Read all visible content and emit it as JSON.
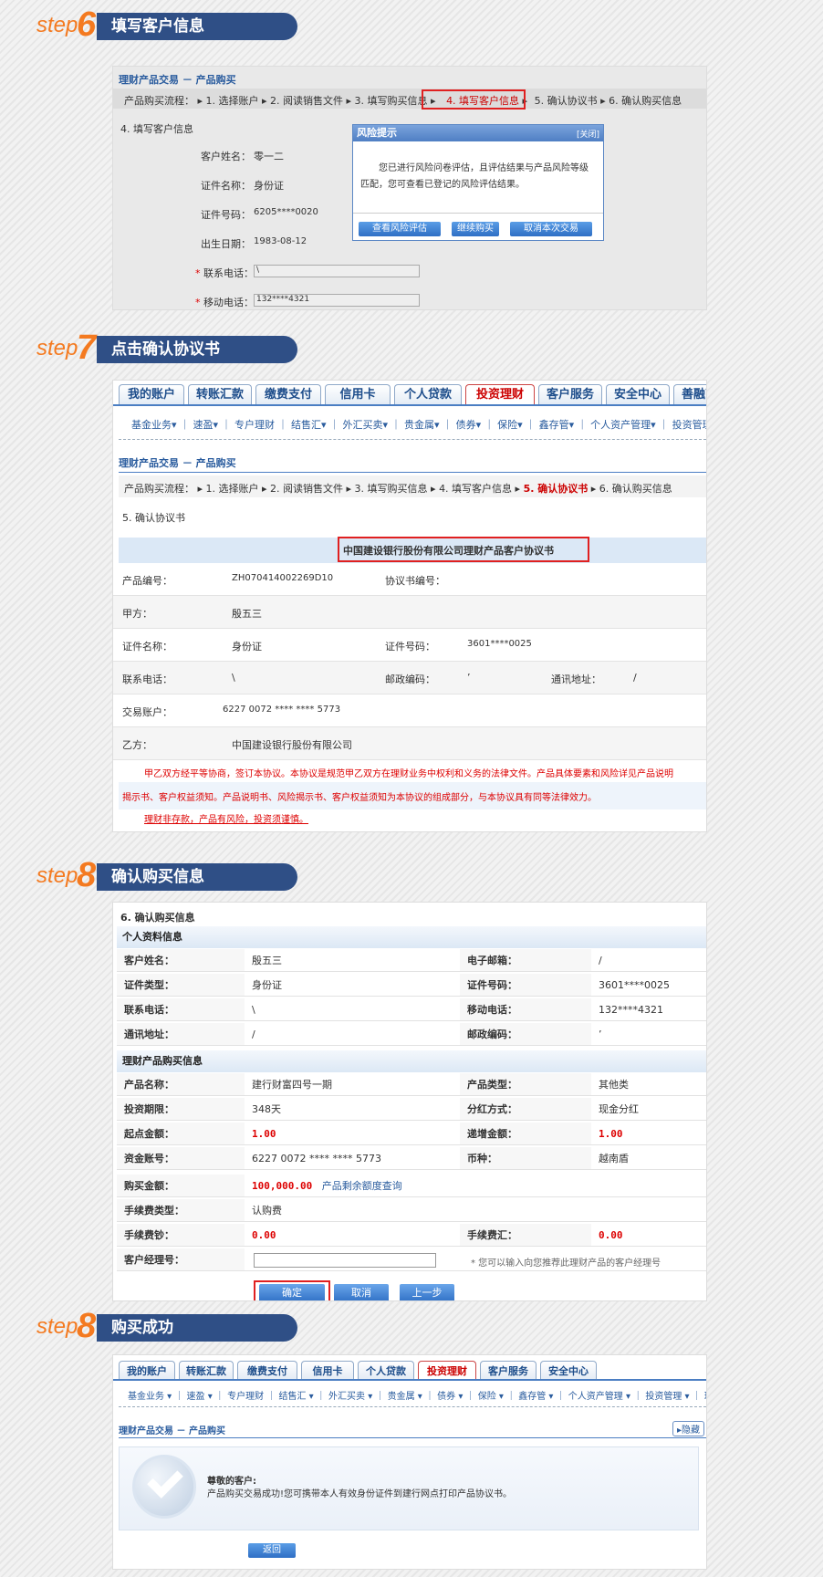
{
  "steps": [
    {
      "word": "step",
      "num": "6",
      "title": "填写客户信息"
    },
    {
      "word": "step",
      "num": "7",
      "title": "点击确认协议书"
    },
    {
      "word": "step",
      "num": "8",
      "title": "确认购买信息"
    },
    {
      "word": "step",
      "num": "8",
      "title": "购买成功"
    }
  ],
  "common": {
    "crumb": "理财产品交易 － 产品购买",
    "flow": [
      "产品购买流程：",
      "1. 选择账户",
      "2. 阅读销售文件",
      "3. 填写购买信息",
      "4. 填写客户信息",
      "5. 确认协议书",
      "6. 确认购买信息"
    ],
    "tabs": [
      "我的账户",
      "转账汇款",
      "缴费支付",
      "信用卡",
      "个人贷款",
      "投资理财",
      "客户服务",
      "安全中心",
      "善融商务"
    ],
    "subnav7": "基金业务▾ ｜ 速盈▾ ｜ 专户理财 ｜ 结售汇▾ ｜ 外汇买卖▾ ｜ 贵金属▾ ｜ 债券▾ ｜ 保险▾ ｜ 鑫存管▾ ｜ 个人资产管理▾ ｜ 投资管理",
    "subnav9": "基金业务 ▾ ｜ 速盈 ▾ ｜ 专户理财 ｜ 结售汇 ▾ ｜ 外汇买卖 ▾ ｜ 贵金属 ▾ ｜ 债券 ▾ ｜ 保险 ▾ ｜ 鑫存管 ▾ ｜ 个人资产管理 ▾ ｜ 投资管理 ▾ ｜ 理财产品"
  },
  "p6": {
    "section": "4. 填写客户信息",
    "fields": [
      {
        "label": "客户姓名：",
        "value": "零一二"
      },
      {
        "label": "证件名称：",
        "value": "身份证"
      },
      {
        "label": "证件号码：",
        "value": "6205****0020"
      },
      {
        "label": "出生日期：",
        "value": "1983-08-12"
      },
      {
        "label": "联系电话：",
        "value": "\\"
      },
      {
        "label": "移动电话：",
        "value": "132****4321"
      }
    ],
    "dialog": {
      "title": "风险提示",
      "close": "[关闭]",
      "text1": "您已进行风险问卷评估，且评估结果与产品风险等级",
      "text2": "匹配，您可查看已登记的风险评估结果。",
      "buttons": [
        "查看风险评估",
        "继续购买",
        "取消本次交易"
      ]
    }
  },
  "p7": {
    "section": "5. 确认协议书",
    "agreement_title": "中国建设银行股份有限公司理财产品客户协议书",
    "rows": [
      {
        "a": "产品编号：",
        "b": "ZH070414002269D10",
        "c": "协议书编号：",
        "d": "",
        "e": "",
        "f": ""
      },
      {
        "a": "甲方：",
        "b": "殷五三",
        "c": "",
        "d": "",
        "e": "",
        "f": ""
      },
      {
        "a": "证件名称：",
        "b": "身份证",
        "c": "证件号码：",
        "d": "3601****0025",
        "e": "",
        "f": ""
      },
      {
        "a": "联系电话：",
        "b": "\\",
        "c": "邮政编码：",
        "d": "’",
        "e": "通讯地址：",
        "f": "/"
      },
      {
        "a": "交易账户：",
        "b": "6227 0072 **** **** 5773",
        "c": "",
        "d": "",
        "e": "",
        "f": ""
      },
      {
        "a": "乙方：",
        "b": "中国建设银行股份有限公司",
        "c": "",
        "d": "",
        "e": "",
        "f": ""
      }
    ],
    "terms1": "甲乙双方经平等协商，签订本协议。本协议是规范甲乙双方在理财业务中权利和义务的法律文件。产品具体要素和风险详见产品说明",
    "terms2": "揭示书、客户权益须知。产品说明书、风险揭示书、客户权益须知为本协议的组成部分，与本协议具有同等法律效力。",
    "warning": "理财非存款，产品有风险，投资须谨慎。"
  },
  "p8": {
    "section": "6. 确认购买信息",
    "sec1": "个人资料信息",
    "sec2": "理财产品购买信息",
    "personal": [
      [
        "客户姓名：",
        "殷五三",
        "电子邮箱：",
        "/"
      ],
      [
        "证件类型：",
        "身份证",
        "证件号码：",
        "3601****0025"
      ],
      [
        "联系电话：",
        "\\",
        "移动电话：",
        "132****4321"
      ],
      [
        "通讯地址：",
        "/",
        "邮政编码：",
        "’"
      ]
    ],
    "product": [
      [
        "产品名称：",
        "建行财富四号一期",
        "产品类型：",
        "其他类"
      ],
      [
        "投资期限：",
        "348天",
        "分红方式：",
        "现金分红"
      ],
      [
        "起点金额：",
        "1.00",
        "递增金额：",
        "1.00"
      ],
      [
        "资金账号：",
        "6227 0072 **** **** 5773",
        "币种：",
        "越南盾"
      ]
    ],
    "amount_label": "购买金额：",
    "amount": "100,000.00",
    "amount_link": "产品剩余额度查询",
    "feetype_label": "手续费类型：",
    "feetype": "认购费",
    "fee1_label": "手续费钞：",
    "fee1": "0.00",
    "fee2_label": "手续费汇：",
    "fee2": "0.00",
    "manager_label": "客户经理号：",
    "manager_hint": "* 您可以输入向您推荐此理财产品的客户经理号",
    "buttons": [
      "确定",
      "取消",
      "上一步"
    ]
  },
  "p9": {
    "tabs": [
      "我的账户",
      "转账汇款",
      "缴费支付",
      "信用卡",
      "个人贷款",
      "投资理财",
      "客户服务",
      "安全中心"
    ],
    "hide": "隐藏",
    "greet": "尊敬的客户:",
    "msg": "产品购买交易成功!您可携带本人有效身份证件到建行网点打印产品协议书。",
    "back": "返回"
  }
}
